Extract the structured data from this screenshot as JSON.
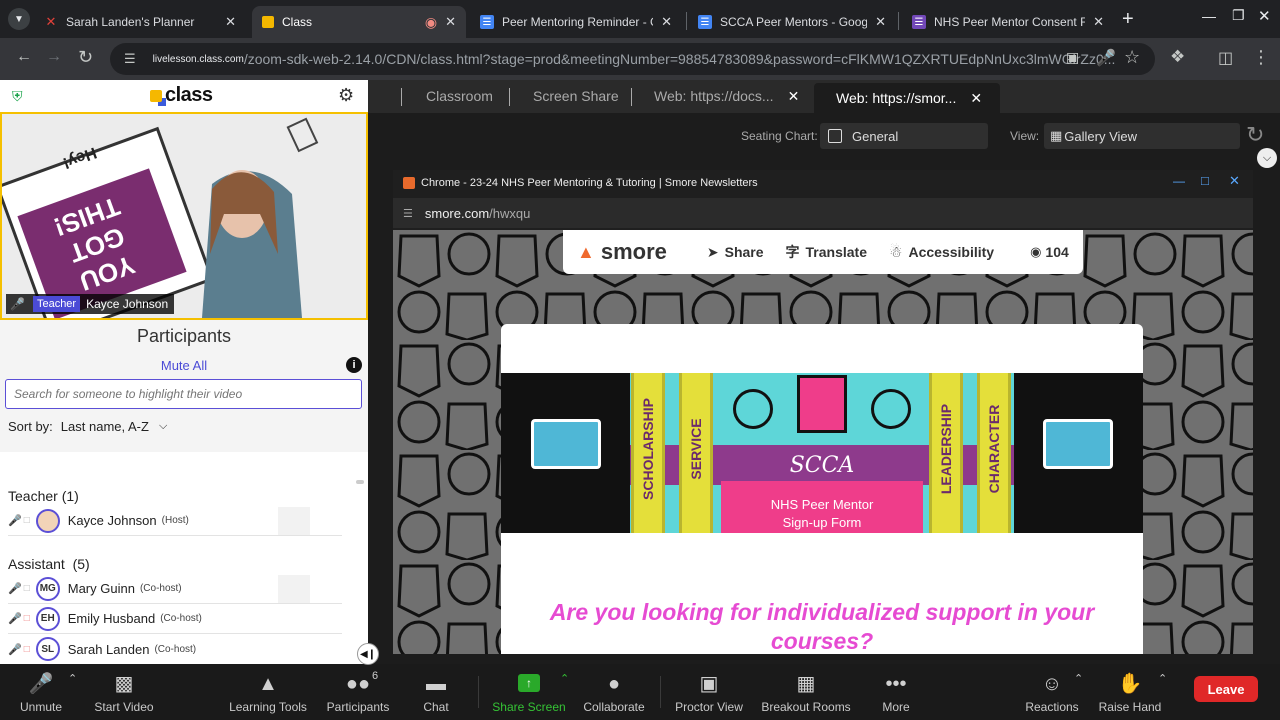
{
  "browser": {
    "tabs": [
      {
        "title": "Sarah Landen's Planner",
        "icon": "planner-icon"
      },
      {
        "title": "Class",
        "icon": "class-icon"
      },
      {
        "title": "Peer Mentoring Reminder - Goo",
        "icon": "google-docs-icon"
      },
      {
        "title": "SCCA Peer Mentors - Google D",
        "icon": "google-docs-icon"
      },
      {
        "title": "NHS Peer Mentor Consent Forr",
        "icon": "google-forms-icon"
      }
    ],
    "url_host": "livelesson.class.com",
    "url_path": "/zoom-sdk-web-2.14.0/CDN/class.html?stage=prod&meetingNumber=98854783089&password=cFlKMW1QZXRTUEdpNnUxc3lmWGlrZz0..."
  },
  "app": {
    "brand": "class"
  },
  "video": {
    "role": "Teacher",
    "name": "Kayce Johnson",
    "sign_top": "Hey!",
    "sign_text": "YOU GOT THIS!"
  },
  "participants": {
    "title": "Participants",
    "mute_all": "Mute All",
    "search_placeholder": "Search for someone to highlight their video",
    "sort_label": "Sort by:",
    "sort_value": "Last name, A-Z",
    "teacher_group": "Teacher (1)",
    "assistant_group": "Assistant  (5)",
    "people": [
      {
        "name": "Kayce Johnson",
        "tag": "(Host)",
        "initials": ""
      },
      {
        "name": "Mary Guinn",
        "tag": "(Co-host)",
        "initials": "MG"
      },
      {
        "name": "Emily Husband",
        "tag": "(Co-host)",
        "initials": "EH"
      },
      {
        "name": "Sarah Landen",
        "tag": "(Co-host)",
        "initials": "SL"
      }
    ]
  },
  "main": {
    "tabs": [
      "Classroom",
      "Screen Share",
      "Web: https://docs...",
      "Web: https://smor..."
    ],
    "seating_label": "Seating Chart:",
    "seating_value": "General",
    "view_label": "View:",
    "view_value": "Gallery View"
  },
  "shared": {
    "window_title": "Chrome - 23-24 NHS Peer Mentoring & Tutoring | Smore Newsletters",
    "url_host": "smore.com",
    "url_path": "/hwxqu",
    "smore_brand": "smore",
    "share": "Share",
    "translate": "Translate",
    "accessibility": "Accessibility",
    "views": "104",
    "banner": {
      "pillars": [
        "SCHOLARSHIP",
        "SERVICE",
        "LEADERSHIP",
        "CHARACTER"
      ],
      "org": "SCCA",
      "line1": "NHS Peer Mentor",
      "line2": "Sign-up Form"
    },
    "headline": "Are you looking for individualized support in your courses?"
  },
  "toolbar": {
    "unmute": "Unmute",
    "start_video": "Start Video",
    "learning_tools": "Learning Tools",
    "participants": "Participants",
    "participants_count": "6",
    "chat": "Chat",
    "share_screen": "Share Screen",
    "collaborate": "Collaborate",
    "proctor_view": "Proctor View",
    "breakout_rooms": "Breakout Rooms",
    "more": "More",
    "reactions": "Reactions",
    "raise_hand": "Raise Hand",
    "leave": "Leave"
  },
  "colors": {
    "accent": "#5b4fd6",
    "share_green": "#2aa92a",
    "leave_red": "#e02828",
    "smore_pink": "#e64bd2"
  }
}
